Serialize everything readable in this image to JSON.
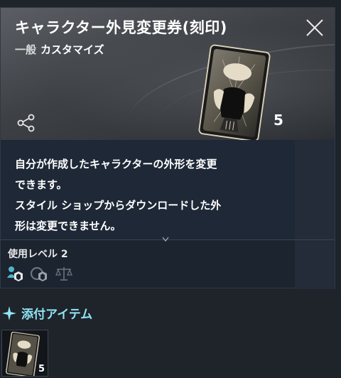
{
  "item": {
    "title": "キャラクター外見変更券(刻印)",
    "category": "一般",
    "subcategory": "カスタマイズ",
    "quantity": "5",
    "description": "自分が作成したキャラクターの外形を変更\nできます。\nスタイル ショップからダウンロードした外\n形は変更できません。",
    "level_label": "使用レベル 2"
  },
  "tags": [
    {
      "icon": "character-bound-icon",
      "color": "#4fb6c8"
    },
    {
      "icon": "account-bound-icon",
      "color": "#6a7480"
    },
    {
      "icon": "tradeable-scale-icon",
      "color": "#6a7480"
    }
  ],
  "attached": {
    "section_label": "添付アイテム",
    "items": [
      {
        "quantity": "5"
      }
    ]
  },
  "colors": {
    "accent": "#8fe4f4",
    "panel_bg": "#1c2430"
  }
}
